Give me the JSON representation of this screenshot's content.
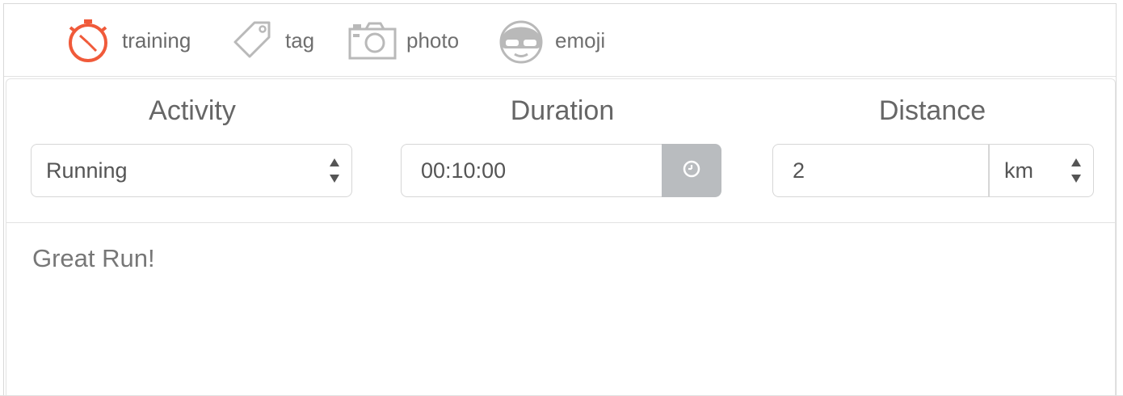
{
  "toolbar": {
    "items": [
      {
        "label": "training",
        "icon": "stopwatch-icon",
        "active": true
      },
      {
        "label": "tag",
        "icon": "tag-icon",
        "active": false
      },
      {
        "label": "photo",
        "icon": "camera-icon",
        "active": false
      },
      {
        "label": "emoji",
        "icon": "face-icon",
        "active": false
      }
    ],
    "active_color": "#f05a3a",
    "inactive_color": "#b9b9b9"
  },
  "form": {
    "activity": {
      "title": "Activity",
      "value": "Running"
    },
    "duration": {
      "title": "Duration",
      "value": "00:10:00",
      "button_icon": "clock-icon"
    },
    "distance": {
      "title": "Distance",
      "value": "2",
      "unit": "km"
    }
  },
  "notes": {
    "text": "Great Run!"
  }
}
